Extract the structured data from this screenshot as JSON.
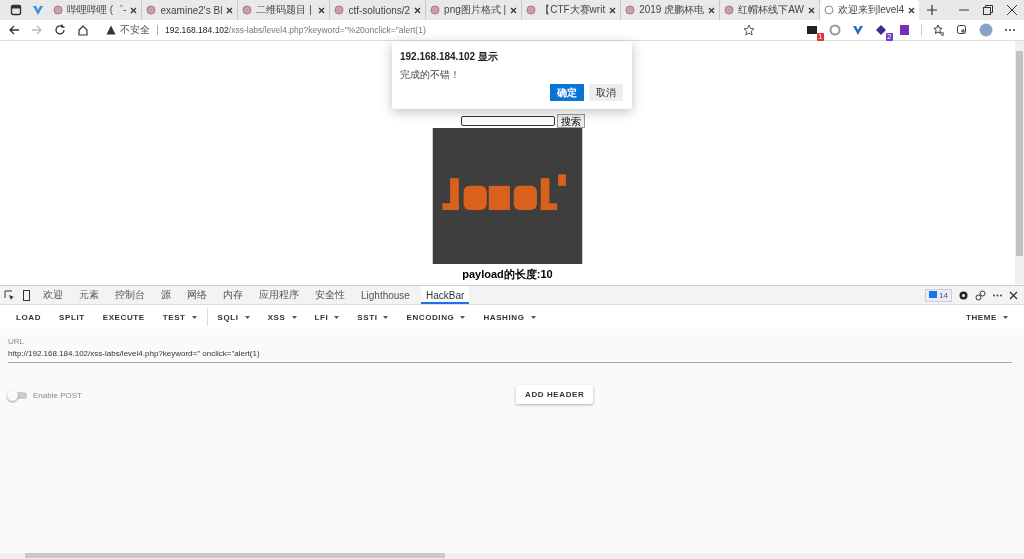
{
  "browser_tabs": [
    {
      "title": "哔哩哔哩 (゜-",
      "selected": false
    },
    {
      "title": "examine2's Bl",
      "selected": false
    },
    {
      "title": "二维码题目 |",
      "selected": false
    },
    {
      "title": "ctf-solutions/2",
      "selected": false
    },
    {
      "title": "png图片格式 |",
      "selected": false
    },
    {
      "title": "【CTF大赛writ",
      "selected": false
    },
    {
      "title": "2019 虎鹏杯电",
      "selected": false
    },
    {
      "title": "红帽杯线下AW",
      "selected": false
    },
    {
      "title": "欢迎来到level4",
      "selected": true
    }
  ],
  "address_bar": {
    "security": "不安全",
    "host": "192.168.184.102",
    "path": "/xss-labs/level4.php?keyword=\"%20onclick=\"alert(1)"
  },
  "extension_badges": [
    "1",
    "2"
  ],
  "page": {
    "search_button": "搜索",
    "payload_length": "payload的长度:10"
  },
  "alert": {
    "title": "192.168.184.102 显示",
    "message": "完成的不错！",
    "ok": "确定",
    "cancel": "取消"
  },
  "devtools_tabs": [
    {
      "label": "欢迎",
      "selected": false
    },
    {
      "label": "元素",
      "selected": false
    },
    {
      "label": "控制台",
      "selected": false
    },
    {
      "label": "源",
      "selected": false
    },
    {
      "label": "网络",
      "selected": false
    },
    {
      "label": "内存",
      "selected": false
    },
    {
      "label": "应用程序",
      "selected": false
    },
    {
      "label": "安全性",
      "selected": false
    },
    {
      "label": "Lighthouse",
      "selected": false
    },
    {
      "label": "HackBar",
      "selected": true
    }
  ],
  "issues_count": "14",
  "hackbar": {
    "menu": [
      {
        "label": "LOAD",
        "dropdown": false
      },
      {
        "label": "SPLIT",
        "dropdown": false
      },
      {
        "label": "EXECUTE",
        "dropdown": false
      },
      {
        "label": "TEST",
        "dropdown": true
      },
      {
        "label": "SQLI",
        "dropdown": true
      },
      {
        "label": "XSS",
        "dropdown": true
      },
      {
        "label": "LFI",
        "dropdown": true
      },
      {
        "label": "SSTI",
        "dropdown": true
      },
      {
        "label": "ENCODING",
        "dropdown": true
      },
      {
        "label": "HASHING",
        "dropdown": true
      }
    ],
    "theme": "THEME",
    "url_label": "URL",
    "url": "http://192.168.184.102/xss-labs/level4.php?keyword=\" onclick=\"alert(1)",
    "enable_post": {
      "label": "Enable POST",
      "on": false
    },
    "add_header": "ADD HEADER"
  }
}
